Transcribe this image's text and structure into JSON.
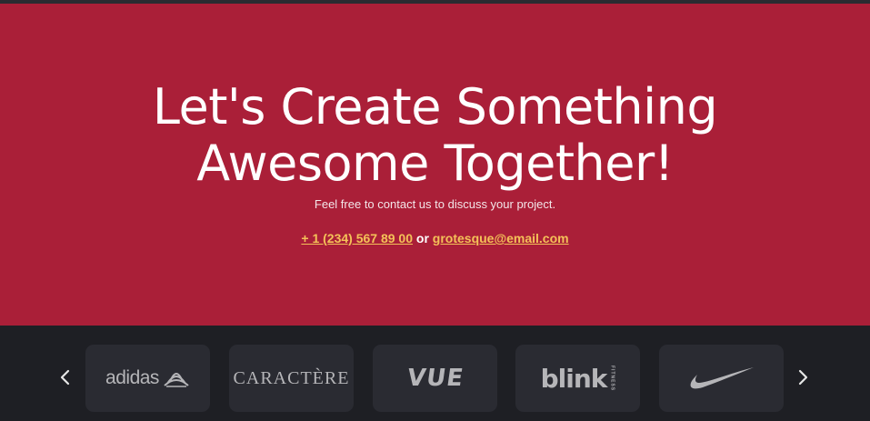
{
  "hero": {
    "title_line1": "Let's Create Something",
    "title_line2": "Awesome Together!",
    "subtitle": "Feel free to contact us to discuss your project.",
    "phone": "+ 1 (234) 567 89 00",
    "connector": " or ",
    "email": "grotesque@email.com"
  },
  "brands": {
    "prev_icon": "chevron-left-icon",
    "next_icon": "chevron-right-icon",
    "items": [
      {
        "name": "adidas"
      },
      {
        "name": "CARACTÈRE"
      },
      {
        "name": "VUE"
      },
      {
        "name": "blink",
        "tagline": "FITNESS"
      },
      {
        "name": "nike-swoosh"
      }
    ]
  },
  "colors": {
    "hero_bg": "#aa1f38",
    "link": "#f4c158",
    "footer_bg": "#1e1f24",
    "card_bg": "#2a2b32",
    "logo": "#b5b5b8"
  }
}
